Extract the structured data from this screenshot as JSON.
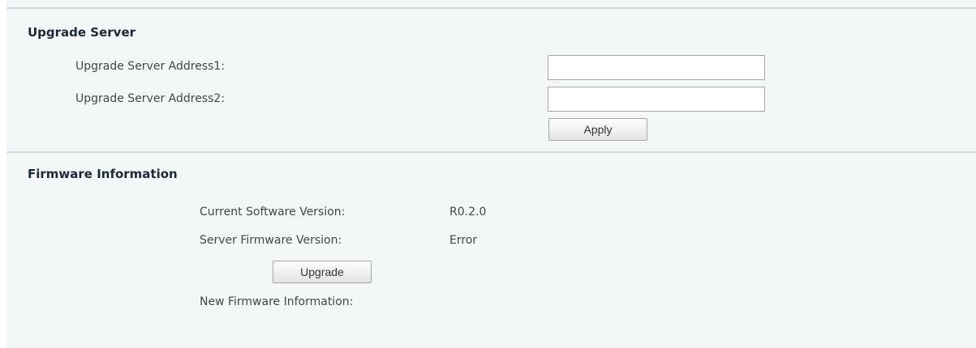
{
  "upgrade_server": {
    "title": "Upgrade Server",
    "address1": {
      "label": "Upgrade Server Address1:",
      "value": "",
      "placeholder": ""
    },
    "address2": {
      "label": "Upgrade Server Address2:",
      "value": "",
      "placeholder": ""
    },
    "apply_label": "Apply"
  },
  "firmware": {
    "title": "Firmware Information",
    "current_label": "Current Software Version:",
    "current_value": "R0.2.0",
    "server_label": "Server Firmware Version:",
    "server_value": "Error",
    "upgrade_label": "Upgrade",
    "new_info_label": "New Firmware Information:",
    "new_info_value": ""
  }
}
